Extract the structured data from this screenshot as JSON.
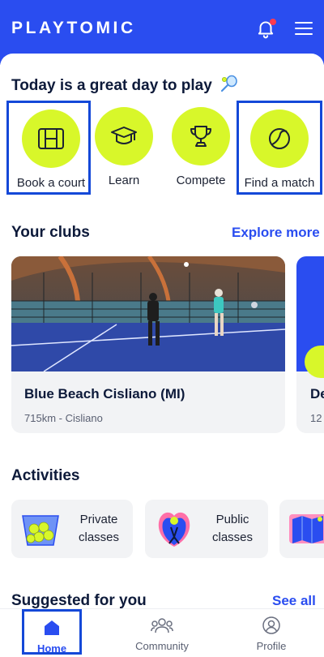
{
  "header": {
    "logo": "PLAYTOMIC",
    "notification_icon": "bell-icon",
    "menu_icon": "hamburger-menu-icon",
    "colors": {
      "brand_blue": "#2a4df0",
      "accent_lime": "#d8f72a",
      "notification_dot": "#ff3b4e"
    }
  },
  "greeting": {
    "text": "Today is a great day to play",
    "icon": "racket-icon"
  },
  "quick_actions": [
    {
      "label": "Book a court",
      "icon": "court-icon"
    },
    {
      "label": "Learn",
      "icon": "graduation-cap-icon"
    },
    {
      "label": "Compete",
      "icon": "trophy-icon"
    },
    {
      "label": "Find a match",
      "icon": "ball-icon"
    }
  ],
  "clubs": {
    "title": "Your clubs",
    "link": "Explore more",
    "cards": [
      {
        "name": "Blue Beach Cisliano (MI)",
        "distance": "715km - Cisliano"
      },
      {
        "name": "De",
        "distance": "12"
      }
    ]
  },
  "activities": {
    "title": "Activities",
    "items": [
      {
        "label_line1": "Private",
        "label_line2": "classes",
        "icon": "ball-basket-icon"
      },
      {
        "label_line1": "Public",
        "label_line2": "classes",
        "icon": "player-icon"
      },
      {
        "label_line1": "",
        "label_line2": "",
        "icon": "map-icon"
      }
    ]
  },
  "suggested": {
    "title": "Suggested for you",
    "link": "See all"
  },
  "bottom_nav": [
    {
      "label": "Home",
      "icon": "home-icon",
      "active": true
    },
    {
      "label": "Community",
      "icon": "community-icon",
      "active": false
    },
    {
      "label": "Profile",
      "icon": "profile-icon",
      "active": false
    }
  ]
}
